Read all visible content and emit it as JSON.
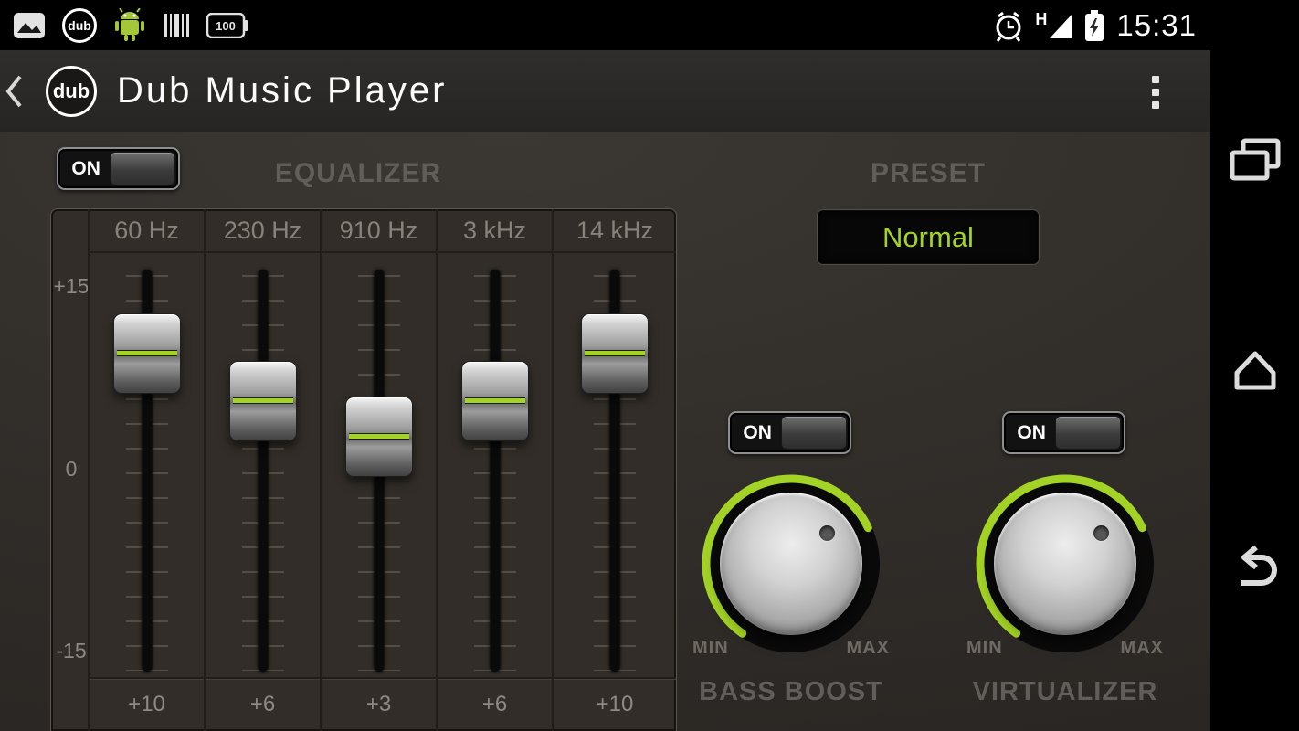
{
  "colors": {
    "accent": "#a3d325",
    "label": "#615e59"
  },
  "status_bar": {
    "time": "15:31",
    "network_type": "H",
    "battery_badge": "100",
    "dub_badge": "dub"
  },
  "app_bar": {
    "logo_text": "dub",
    "title": "Dub Music Player"
  },
  "equalizer": {
    "power_toggle": "ON",
    "title": "EQUALIZER",
    "scale": [
      "+15",
      "0",
      "-15"
    ],
    "bands": [
      {
        "freq": "60 Hz",
        "gain_label": "+10",
        "level": 10
      },
      {
        "freq": "230 Hz",
        "gain_label": "+6",
        "level": 6
      },
      {
        "freq": "910 Hz",
        "gain_label": "+3",
        "level": 3
      },
      {
        "freq": "3 kHz",
        "gain_label": "+6",
        "level": 6
      },
      {
        "freq": "14 kHz",
        "gain_label": "+10",
        "level": 10
      }
    ]
  },
  "preset": {
    "title": "PRESET",
    "selected": "Normal"
  },
  "bass_boost": {
    "toggle": "ON",
    "title": "BASS BOOST",
    "min": "MIN",
    "max": "MAX"
  },
  "virtualizer": {
    "toggle": "ON",
    "title": "VIRTUALIZER",
    "min": "MIN",
    "max": "MAX"
  }
}
